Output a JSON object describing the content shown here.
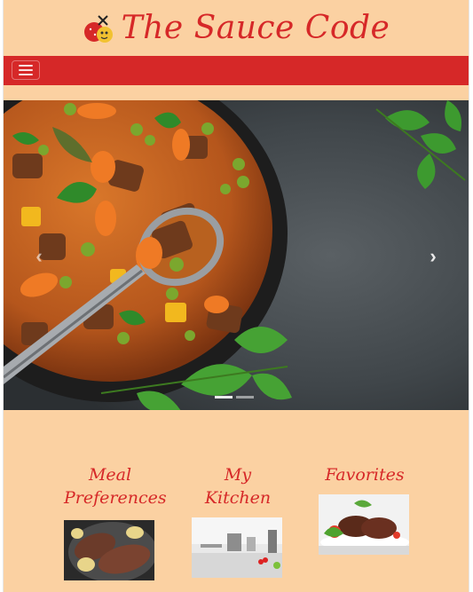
{
  "header": {
    "title": "The Sauce Code",
    "logo_icon": "sauce-logo-icon"
  },
  "navbar": {
    "toggle_icon": "hamburger-menu-icon"
  },
  "hero": {
    "next_icon": "chevron-right-icon",
    "prev_icon": "chevron-left-icon"
  },
  "cards": [
    {
      "title_line1": "Meal",
      "title_line2": "Preferences",
      "icon": "steak-plate-icon"
    },
    {
      "title_line1": "My Kitchen",
      "title_line2": "",
      "icon": "kitchen-photo-icon"
    },
    {
      "title_line1": "Favorites",
      "title_line2": "",
      "icon": "grilled-meat-icon"
    }
  ],
  "colors": {
    "brand_red": "#d62828",
    "page_bg": "#fbd1a2"
  }
}
